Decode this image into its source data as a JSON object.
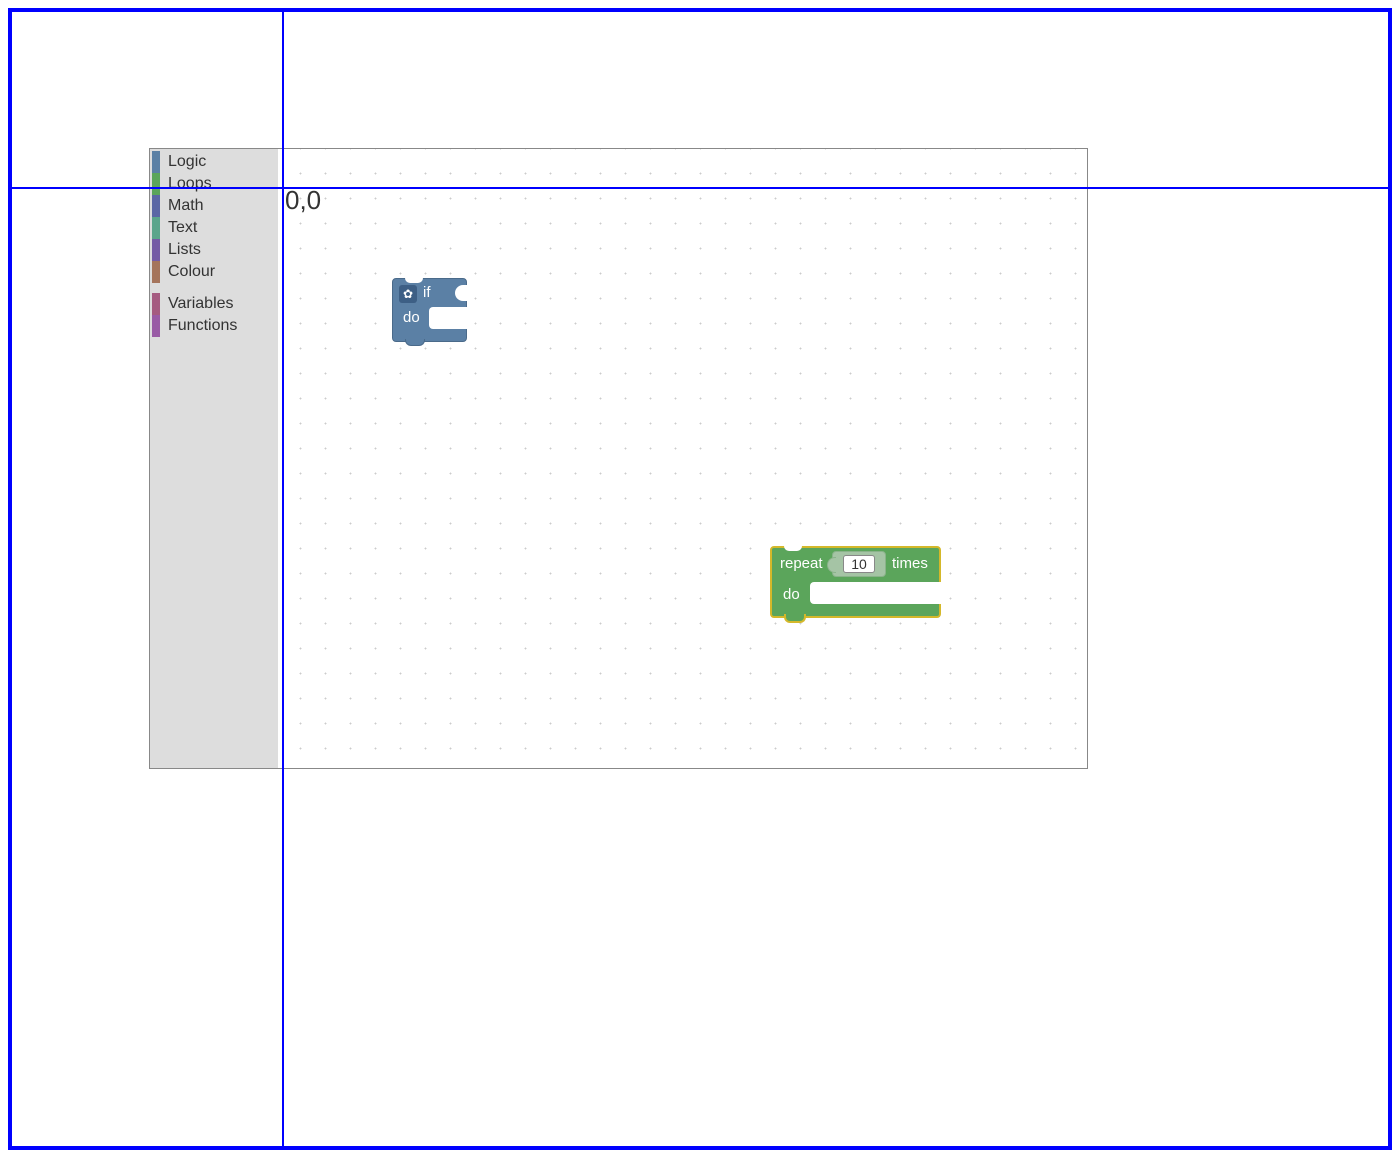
{
  "origin_label": "0,0",
  "toolbox": {
    "categories": [
      {
        "label": "Logic",
        "color": "#5b80a5"
      },
      {
        "label": "Loops",
        "color": "#5ba55b"
      },
      {
        "label": "Math",
        "color": "#5b67a5"
      },
      {
        "label": "Text",
        "color": "#5ba58c"
      },
      {
        "label": "Lists",
        "color": "#745ba5"
      },
      {
        "label": "Colour",
        "color": "#a5745b"
      }
    ],
    "categories2": [
      {
        "label": "Variables",
        "color": "#a55b80"
      },
      {
        "label": "Functions",
        "color": "#995ba5"
      }
    ]
  },
  "blocks": {
    "if": {
      "if_label": "if",
      "do_label": "do"
    },
    "repeat": {
      "repeat_label": "repeat",
      "times_label": "times",
      "do_label": "do",
      "number_value": "10"
    }
  }
}
